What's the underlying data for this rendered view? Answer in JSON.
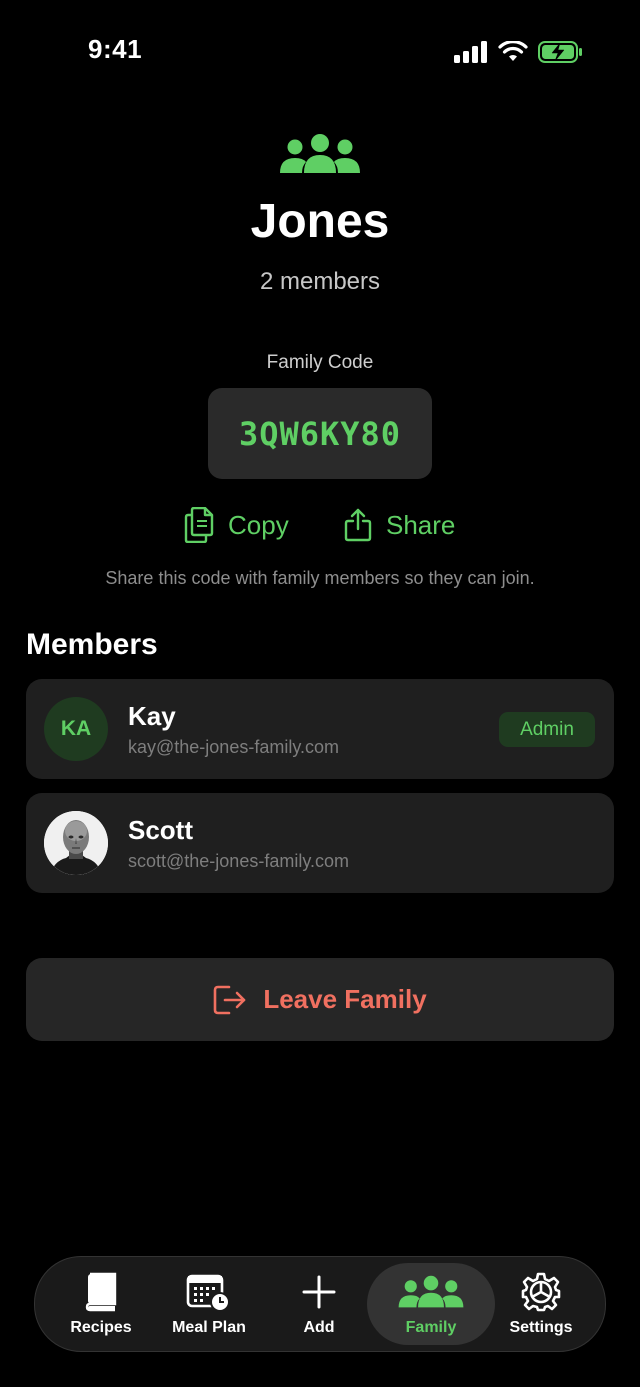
{
  "status_bar": {
    "time": "9:41"
  },
  "family": {
    "name": "Jones",
    "member_count": "2 members",
    "code_label": "Family Code",
    "code": "3QW6KY80",
    "copy_label": "Copy",
    "share_label": "Share",
    "hint": "Share this code with family members so they can join."
  },
  "members": {
    "title": "Members",
    "items": [
      {
        "initials": "KA",
        "name": "Kay",
        "email": "kay@the-jones-family.com",
        "badge": "Admin"
      },
      {
        "name": "Scott",
        "email": "scott@the-jones-family.com"
      }
    ]
  },
  "leave": {
    "label": "Leave Family"
  },
  "tabbar": {
    "tabs": [
      {
        "label": "Recipes",
        "icon": "book-icon"
      },
      {
        "label": "Meal Plan",
        "icon": "calendar-clock-icon"
      },
      {
        "label": "Add",
        "icon": "plus-icon"
      },
      {
        "label": "Family",
        "icon": "people-icon",
        "active": true
      },
      {
        "label": "Settings",
        "icon": "gear-icon"
      }
    ]
  },
  "colors": {
    "accent": "#5fcf64",
    "danger": "#f07060",
    "background": "#000000",
    "card": "#1f1f1f"
  }
}
